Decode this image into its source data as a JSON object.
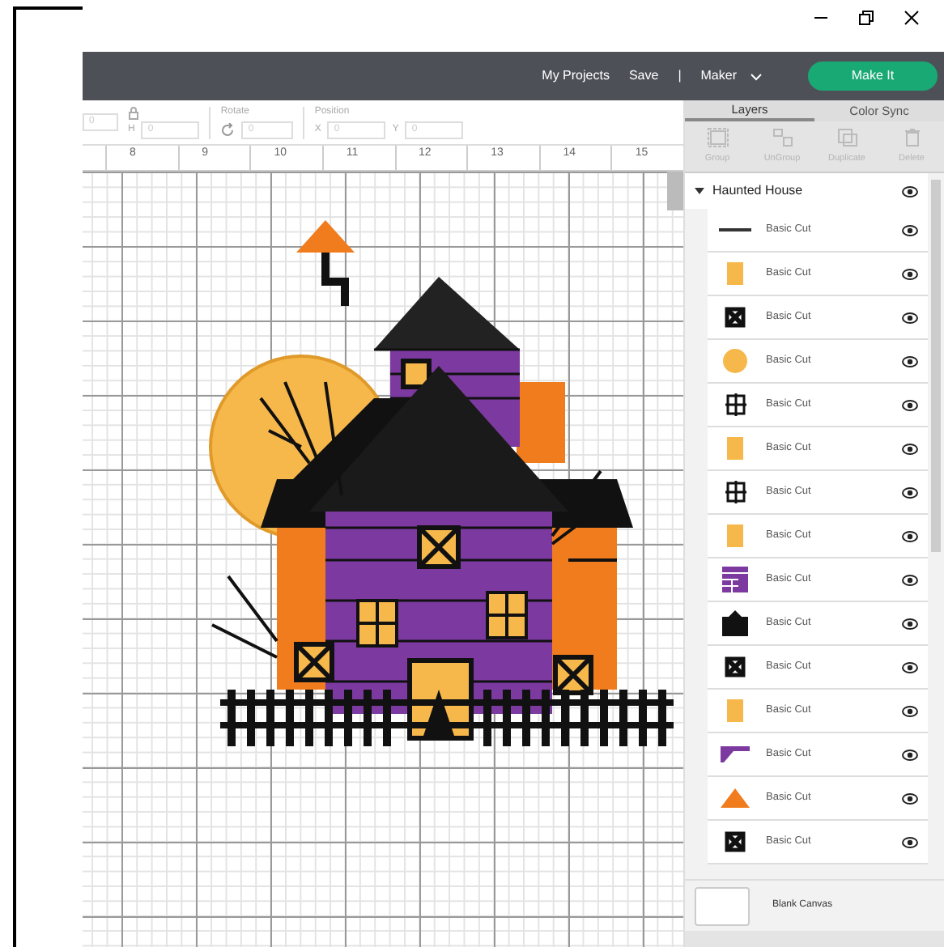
{
  "header": {
    "links": [
      "My Projects",
      "Save"
    ],
    "separator": "|",
    "machine": "Maker",
    "make_button": "Make It"
  },
  "toolbar": {
    "size": {
      "h_label": "H",
      "h_value": "0",
      "w_value": "0"
    },
    "rotate": {
      "label": "Rotate",
      "value": "0"
    },
    "position": {
      "label": "Position",
      "x_label": "X",
      "x_value": "0",
      "y_label": "Y",
      "y_value": "0"
    }
  },
  "ruler": [
    "8",
    "9",
    "10",
    "11",
    "12",
    "13",
    "14",
    "15"
  ],
  "panel": {
    "tabs": [
      {
        "label": "Layers",
        "selected": true
      },
      {
        "label": "Color Sync",
        "selected": false
      }
    ],
    "actions": [
      {
        "label": "Group",
        "kind": "group"
      },
      {
        "label": "UnGroup",
        "kind": "ungroup"
      },
      {
        "label": "Duplicate",
        "kind": "duplicate"
      },
      {
        "label": "Delete",
        "kind": "delete"
      }
    ],
    "group": {
      "name": "Haunted House",
      "expanded": true
    },
    "layers": [
      {
        "name": "Basic Cut",
        "kind": "line"
      },
      {
        "name": "Basic Cut",
        "kind": "rect"
      },
      {
        "name": "Basic Cut",
        "kind": "xbox"
      },
      {
        "name": "Basic Cut",
        "kind": "circle"
      },
      {
        "name": "Basic Cut",
        "kind": "window"
      },
      {
        "name": "Basic Cut",
        "kind": "rect"
      },
      {
        "name": "Basic Cut",
        "kind": "window"
      },
      {
        "name": "Basic Cut",
        "kind": "rect"
      },
      {
        "name": "Basic Cut",
        "kind": "planks"
      },
      {
        "name": "Basic Cut",
        "kind": "house"
      },
      {
        "name": "Basic Cut",
        "kind": "xbox"
      },
      {
        "name": "Basic Cut",
        "kind": "rect"
      },
      {
        "name": "Basic Cut",
        "kind": "roof"
      },
      {
        "name": "Basic Cut",
        "kind": "triangle"
      },
      {
        "name": "Basic Cut",
        "kind": "xbox"
      }
    ],
    "canvas_label": "Blank Canvas"
  }
}
